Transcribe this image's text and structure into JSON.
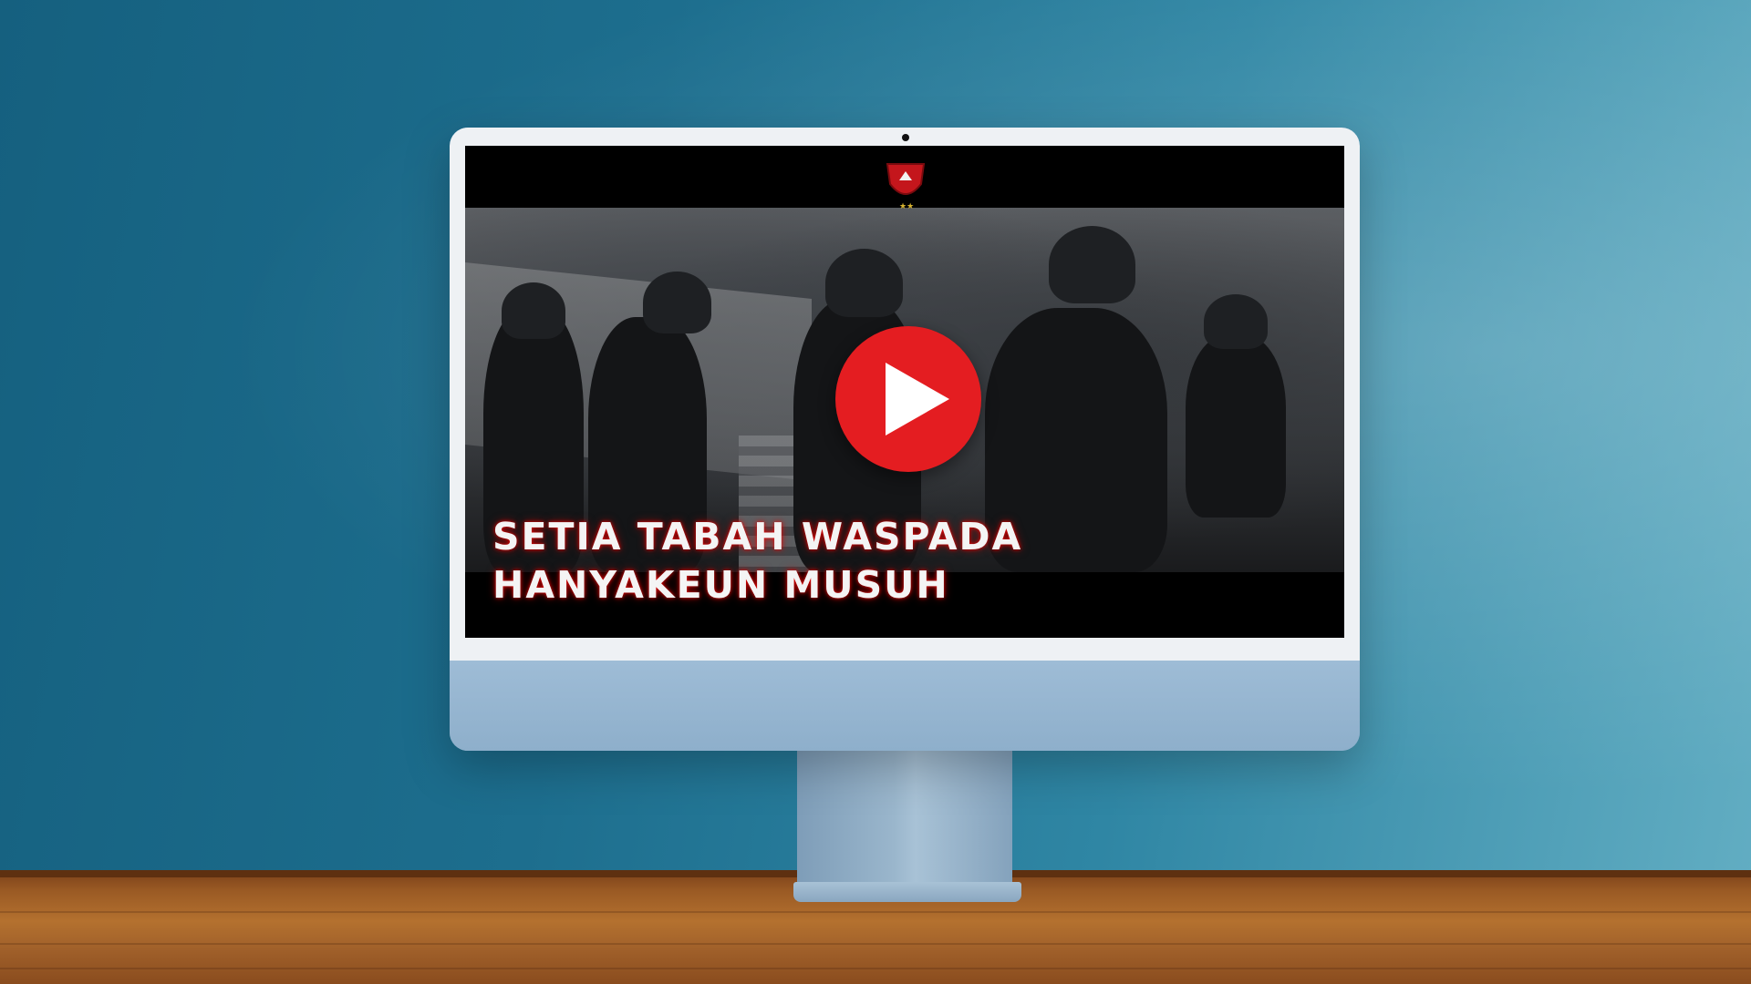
{
  "video": {
    "caption_line_1": "SETIA TABAH WASPADA",
    "caption_line_2": "HANYAKEUN MUSUH",
    "play_icon": "play-icon",
    "logo_icon": "unit-emblem-icon"
  },
  "colors": {
    "play_button": "#e41d21",
    "caption_glow": "#ff0000",
    "wall": "#1d6e8e",
    "imac_body": "#8fb1cc"
  }
}
